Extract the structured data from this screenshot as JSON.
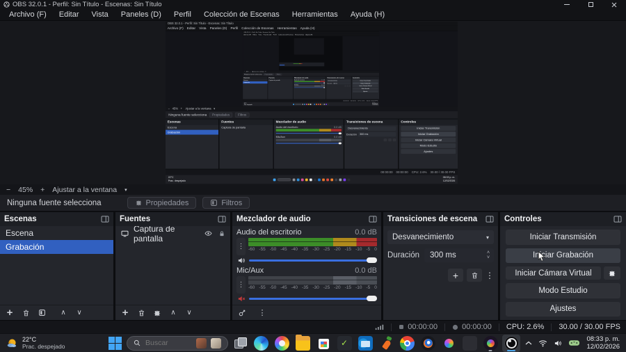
{
  "window": {
    "title": "OBS 32.0.1 - Perfil: Sin Título - Escenas: Sin Título"
  },
  "menu": {
    "items": [
      "Archivo (F)",
      "Editar",
      "Vista",
      "Paneles (D)",
      "Perfil",
      "Colección de Escenas",
      "Herramientas",
      "Ayuda (H)"
    ]
  },
  "zoombar": {
    "zoom_out": "−",
    "zoom_level": "45%",
    "zoom_in": "+",
    "fit_label": "Ajustar a la ventana",
    "fit_caret": "▾"
  },
  "source_toolbar": {
    "message": "Ninguna fuente selecciona",
    "properties_label": "Propiedades",
    "filters_label": "Filtros"
  },
  "scenes": {
    "title": "Escenas",
    "items": [
      {
        "label": "Escena",
        "selected": false
      },
      {
        "label": "Grabación",
        "selected": true
      }
    ]
  },
  "sources": {
    "title": "Fuentes",
    "items": [
      {
        "label": "Captura de pantalla"
      }
    ]
  },
  "mixer": {
    "title": "Mezclador de audio",
    "ticks": [
      "-60",
      "-55",
      "-50",
      "-45",
      "-40",
      "-35",
      "-30",
      "-25",
      "-20",
      "-15",
      "-10",
      "-5",
      "0"
    ],
    "channels": [
      {
        "name": "Audio del escritorio",
        "db": "0.0 dB",
        "muted": false
      },
      {
        "name": "Mic/Aux",
        "db": "0.0 dB",
        "muted": true
      }
    ]
  },
  "transitions": {
    "title": "Transiciones de escena",
    "selected": "Desvanecimiento",
    "caret": "▾",
    "duration_label": "Duración",
    "duration_value": "300 ms"
  },
  "controls": {
    "title": "Controles",
    "buttons": [
      {
        "label": "Iniciar Transmisión"
      },
      {
        "label": "Iniciar Grabación",
        "hover": true
      },
      {
        "label": "Iniciar Cámara Virtual",
        "gear": true
      },
      {
        "label": "Modo Estudio"
      },
      {
        "label": "Ajustes"
      }
    ]
  },
  "status_bar": {
    "stream_time": "00:00:00",
    "record_time": "00:00:00",
    "cpu": "CPU: 2.6%",
    "fps": "30.00 / 30.00 FPS"
  },
  "taskbar": {
    "weather": {
      "temp": "22°C",
      "condition": "Prac. despejado"
    },
    "search_placeholder": "Buscar",
    "app_icons": [
      {
        "name": "task-view"
      },
      {
        "name": "edge"
      },
      {
        "name": "paint"
      },
      {
        "name": "file-explorer"
      },
      {
        "name": "store"
      },
      {
        "name": "todo"
      },
      {
        "name": "outlook"
      },
      {
        "name": "carrot"
      },
      {
        "name": "chrome"
      },
      {
        "name": "blender"
      },
      {
        "name": "photos"
      },
      {
        "name": "ghost"
      },
      {
        "name": "clipchamp",
        "running": true
      },
      {
        "name": "obs",
        "running": true,
        "active": true
      }
    ],
    "clock": {
      "time": "08:33 p. m.",
      "date": "12/02/2026"
    }
  },
  "icons": {
    "plus": "+",
    "kebab": "⋮",
    "up": "∧",
    "down": "∨",
    "caret_up_small": "˄",
    "caret_dn_small": "˅"
  },
  "colors": {
    "accent_blue": "#3160c0",
    "meter_green": "#3c8d28",
    "meter_yellow": "#b08a1c",
    "meter_red": "#a52a2d",
    "slider_blue": "#3a6fe0",
    "mute_red": "#c23a3a"
  }
}
